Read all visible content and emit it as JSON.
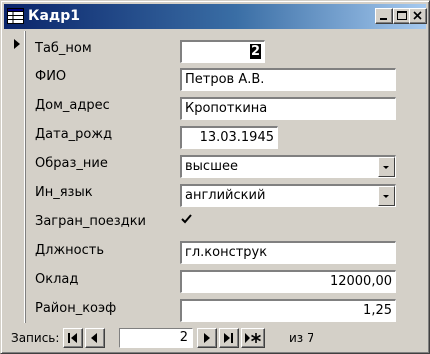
{
  "window": {
    "title": "Кадр1",
    "titlebar_icon": "datasheet-form-icon",
    "buttons": [
      "minimize-icon",
      "maximize-icon",
      "close-icon"
    ]
  },
  "form": {
    "fields": [
      {
        "label": "Таб_ном",
        "value": "2"
      },
      {
        "label": "ФИО",
        "value": "Петров А.В."
      },
      {
        "label": "Дом_адрес",
        "value": "Кропоткина"
      },
      {
        "label": "Дата_рожд",
        "value": "13.03.1945"
      },
      {
        "label": "Образ_ние",
        "value": "высшее"
      },
      {
        "label": "Ин_язык",
        "value": "английский"
      },
      {
        "label": "Загран_поездки",
        "value": true
      },
      {
        "label": "Длжность",
        "value": "гл.конструк"
      },
      {
        "label": "Оклад",
        "value": "12000,00"
      },
      {
        "label": "Район_коэф",
        "value": "1,25"
      }
    ]
  },
  "navigation": {
    "record_label": "Запись:",
    "current_record": "2",
    "of_label": "из 7",
    "buttons": [
      "first-record-icon",
      "prev-record-icon",
      "next-record-icon",
      "last-record-icon",
      "new-record-icon"
    ]
  },
  "colors": {
    "titlebar_start": "#0a246a",
    "titlebar_end": "#a6caf0",
    "face": "#d4d0c8"
  }
}
